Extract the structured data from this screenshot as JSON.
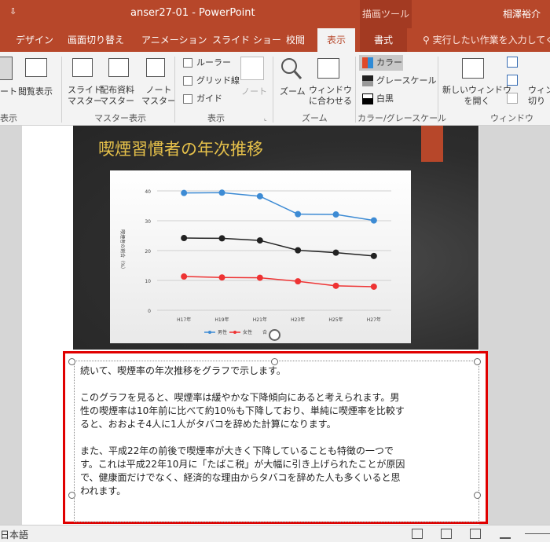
{
  "titlebar": {
    "quick_access": "⇩",
    "title": "anser27-01  -  PowerPoint",
    "tool_context": "描画ツール",
    "user": "相澤裕介"
  },
  "tabs": [
    {
      "label": "デザイン"
    },
    {
      "label": "画面切り替え"
    },
    {
      "label": "アニメーション"
    },
    {
      "label": "スライド ショー"
    },
    {
      "label": "校閲"
    },
    {
      "label": "表示"
    },
    {
      "label": "書式"
    }
  ],
  "search": {
    "placeholder": "実行したい作業を入力してくだ"
  },
  "ribbon": {
    "groups": {
      "presentation_views": "表示",
      "master_views": "マスター表示",
      "show": "表示",
      "zoom": "ズーム",
      "color": "カラー/グレースケール",
      "window": "ウィンドウ"
    },
    "buttons": {
      "note": "ート",
      "reading_view": "閲覧表示",
      "slide_master_1": "スライド",
      "slide_master_2": "マスター",
      "handout_master_1": "配布資料",
      "handout_master_2": "マスター",
      "notes_master_1": "ノート",
      "notes_master_2": "マスター",
      "ruler": "ルーラー",
      "gridlines": "グリッド線",
      "guides": "ガイド",
      "notes_pane": "ノート",
      "zoom": "ズーム",
      "fit_window_1": "ウィンドウ",
      "fit_window_2": "に合わせる",
      "color": "カラー",
      "grayscale": "グレースケール",
      "bw": "白黒",
      "new_window_1": "新しいウィンドウ",
      "new_window_2": "を開く",
      "switch_window_1": "ウィン",
      "switch_window_2": "切り"
    }
  },
  "slide": {
    "title": "喫煙習慣者の年次推移"
  },
  "chart_data": {
    "type": "line",
    "title": "",
    "ylabel": "喫煙者の割合（%）",
    "xlabel": "",
    "categories": [
      "H17年",
      "H19年",
      "H21年",
      "H23年",
      "H25年",
      "H27年"
    ],
    "ylim": [
      0,
      40
    ],
    "yticks": [
      "0",
      "10",
      "20",
      "30",
      "40"
    ],
    "grid": true,
    "legend": "bottom",
    "series": [
      {
        "name": "男性",
        "color": "#3d8bd4",
        "values": [
          39.3,
          39.4,
          38.2,
          32.2,
          32.1,
          30.1
        ]
      },
      {
        "name": "女性",
        "color": "#ee3333",
        "values": [
          11.3,
          11.0,
          10.9,
          9.7,
          8.2,
          7.9
        ]
      },
      {
        "name": "",
        "color": "#222222",
        "values": [
          24.2,
          24.1,
          23.4,
          20.1,
          19.3,
          18.2
        ]
      }
    ],
    "legend_extra": "合"
  },
  "notes": {
    "line1": "続いて、喫煙率の年次推移をグラフで示します。",
    "p2_l1": "このグラフを見ると、喫煙率は緩やかな下降傾向にあると考えられます。男",
    "p2_l2": "性の喫煙率は10年前に比べて約10％も下降しており、単純に喫煙率を比較す",
    "p2_l3": "ると、おおよそ4人に1人がタバコを辞めた計算になります。",
    "p3_l1": "また、平成22年の前後で喫煙率が大きく下降していることも特徴の一つで",
    "p3_l2": "す。これは平成22年10月に「たばこ税」が大幅に引き上げられたことが原因",
    "p3_l3": "で、健康面だけでなく、経済的な理由からタバコを辞めた人も多くいると思",
    "p3_l4": "われます。"
  },
  "statusbar": {
    "language": "日本語"
  }
}
